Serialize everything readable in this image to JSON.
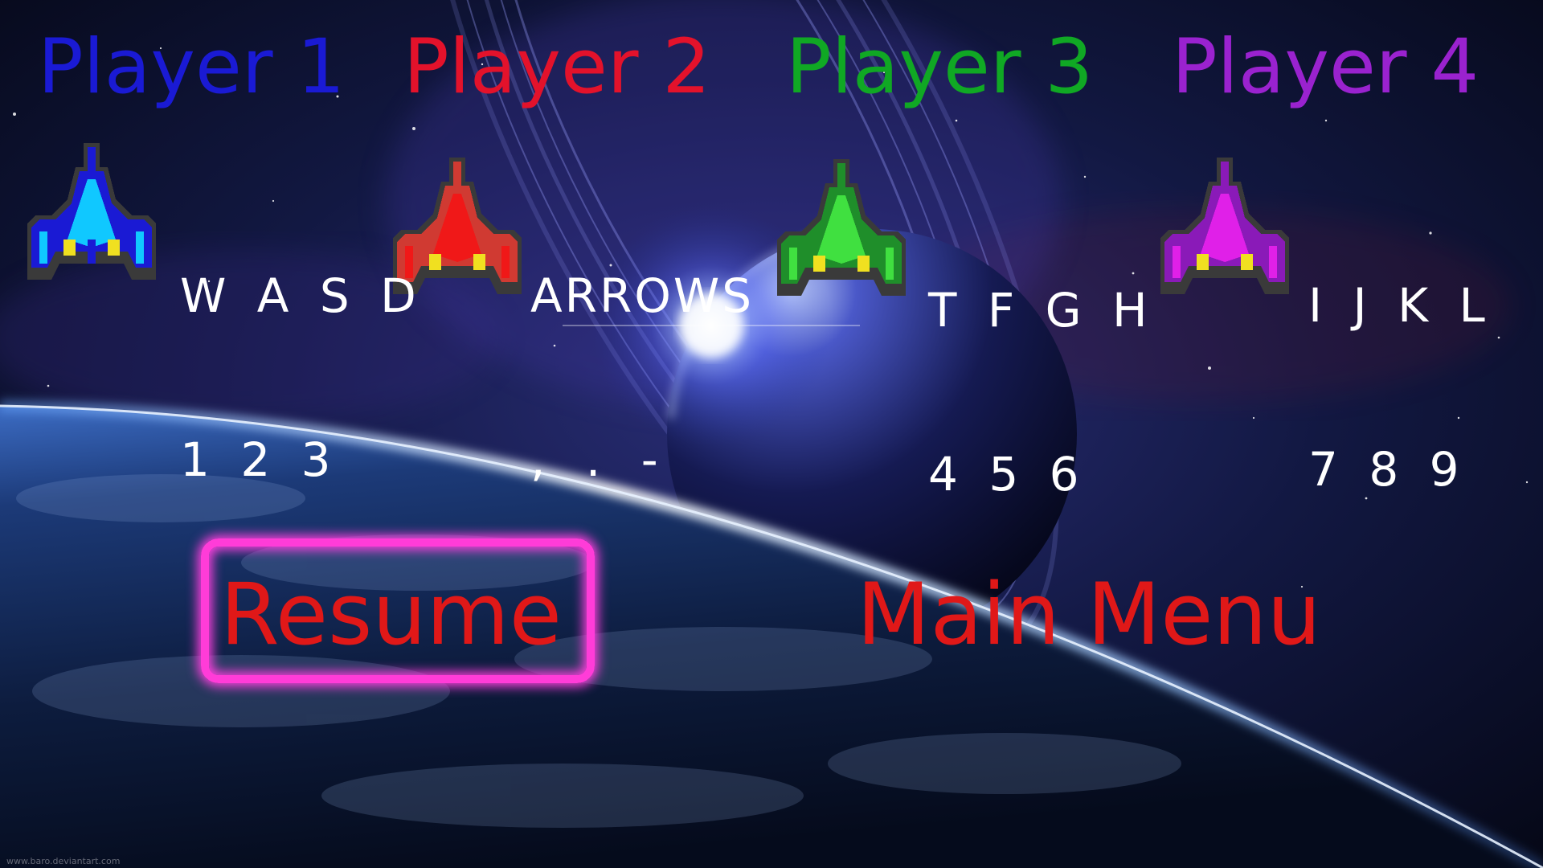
{
  "colors": {
    "player1": "#1a1ad4",
    "player2": "#e3122b",
    "player3": "#10a824",
    "player4": "#9a22cf",
    "menu_text": "#e01818",
    "selection_frame": "#ff3cd8",
    "controls_text": "#ffffff"
  },
  "players": [
    {
      "title": "Player 1",
      "ship_icon": "blue-spaceship-icon",
      "controls_line1": "W A S D",
      "controls_line2": "1 2 3"
    },
    {
      "title": "Player 2",
      "ship_icon": "red-spaceship-icon",
      "controls_line1": "ARROWS",
      "controls_line2": ", . -"
    },
    {
      "title": "Player 3",
      "ship_icon": "green-spaceship-icon",
      "controls_line1": "T F G H",
      "controls_line2": "4 5 6"
    },
    {
      "title": "Player 4",
      "ship_icon": "purple-spaceship-icon",
      "controls_line1": "I J K L",
      "controls_line2": "7 8 9"
    }
  ],
  "menu": {
    "resume_label": "Resume",
    "main_menu_label": "Main Menu",
    "selected": "resume"
  },
  "watermark": "www.baro.deviantart.com"
}
